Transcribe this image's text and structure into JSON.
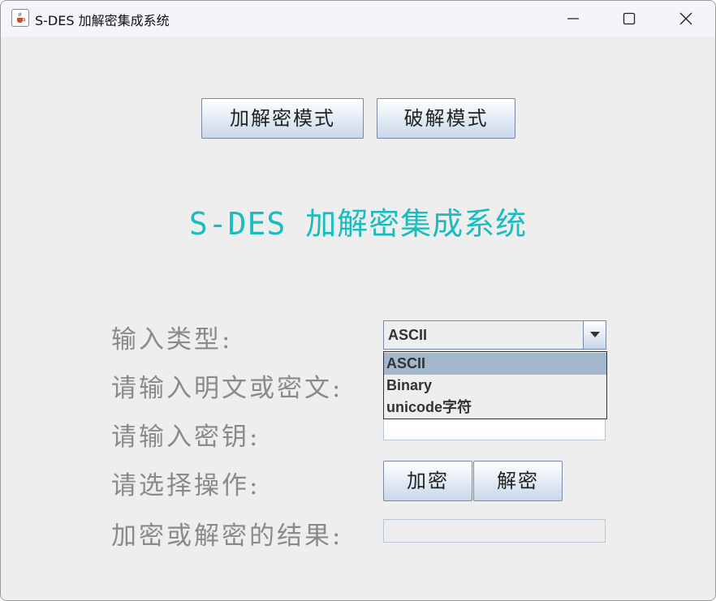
{
  "window": {
    "title": "S-DES 加解密集成系统"
  },
  "modes": {
    "encrypt_decrypt_label": "加解密模式",
    "crack_label": "破解模式"
  },
  "main": {
    "heading": "S-DES 加解密集成系统"
  },
  "form": {
    "input_type_label": "输入类型:",
    "input_type_selected": "ASCII",
    "input_type_options": [
      "ASCII",
      "Binary",
      "unicode字符"
    ],
    "text_label": "请输入明文或密文:",
    "text_value": "",
    "key_label": "请输入密钥:",
    "key_value": "",
    "operation_label": "请选择操作:",
    "encrypt_label": "加密",
    "decrypt_label": "解密",
    "result_label": "加密或解密的结果:",
    "result_value": ""
  },
  "colors": {
    "heading": "#19bdbd",
    "label": "#8a8a8a",
    "selected_option": "#a3b8cc"
  }
}
